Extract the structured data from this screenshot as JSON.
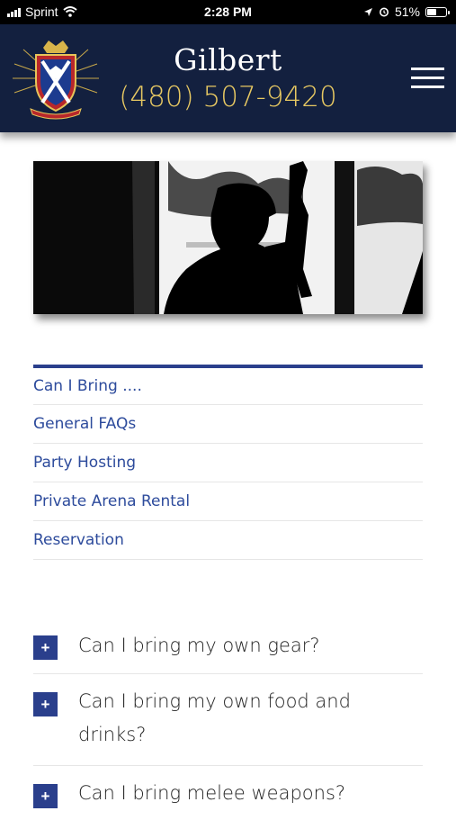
{
  "status_bar": {
    "carrier": "Sprint",
    "time": "2:28 PM",
    "battery": "51%",
    "battery_level": 0.51
  },
  "header": {
    "site_name": "Gilbert",
    "phone": "(480) 507-9420"
  },
  "subnav": {
    "items": [
      {
        "label": "Can I Bring ...."
      },
      {
        "label": "General FAQs"
      },
      {
        "label": "Party Hosting"
      },
      {
        "label": "Private Arena Rental"
      },
      {
        "label": "Reservation"
      }
    ]
  },
  "faq": {
    "expand_symbol": "+",
    "items": [
      {
        "question": "Can I bring my own gear?"
      },
      {
        "question": "Can I bring my own food and drinks?"
      },
      {
        "question": "Can I bring melee weapons?"
      }
    ]
  },
  "colors": {
    "header_bg": "#13203f",
    "phone": "#e7c862",
    "accent": "#2a3f8c",
    "link": "#2d4b9c"
  }
}
